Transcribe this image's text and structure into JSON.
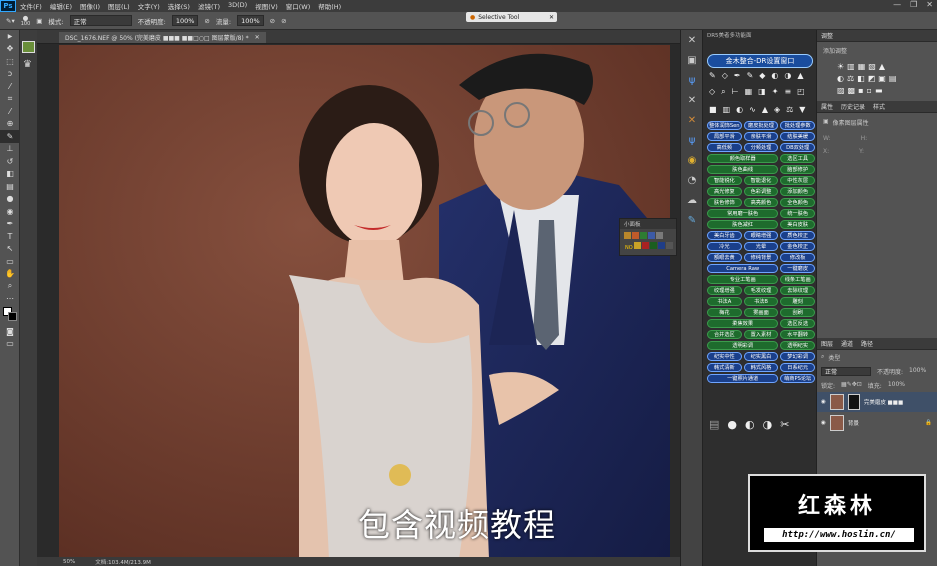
{
  "menubar": {
    "logo": "Ps",
    "items": [
      "文件(F)",
      "编辑(E)",
      "图像(I)",
      "图层(L)",
      "文字(Y)",
      "选择(S)",
      "滤镜(T)",
      "3D(D)",
      "视图(V)",
      "窗口(W)",
      "帮助(H)"
    ],
    "window_controls": [
      "—",
      "❐",
      "✕"
    ]
  },
  "options": {
    "brush_size": "100",
    "mode_label": "模式:",
    "mode_value": "正常",
    "opacity_label": "不透明度:",
    "opacity_value": "100%",
    "flow_label": "流量:",
    "flow_value": "100%"
  },
  "selective_tool": {
    "label": "Selective Tool"
  },
  "document": {
    "tab": "DSC_1676.NEF @ 50% (完美磨皮 ■■■ ■■□○□ 图层蒙版/8) *",
    "zoom": "50%",
    "doc_size": "文档:103.4M/213.9M",
    "subtitle": "包含视频教程"
  },
  "xiaomianban": {
    "title": "小面板",
    "swatches": [
      "#b8862b",
      "#c05a2a",
      "#2e7d32",
      "#3c5aa6",
      "#7a7a7a",
      "#c9a227",
      "#aa2222",
      "#1b5e20",
      "#1f3d87",
      "#555555"
    ],
    "no_label": "NO"
  },
  "dr_panel": {
    "title": "DR5美者多功能面",
    "main_button": "金木整合-DR设置窗口",
    "buttons": [
      {
        "label": "整体润饰Sen",
        "c": "b"
      },
      {
        "label": "磨皮批处理",
        "c": "b"
      },
      {
        "label": "批处理参数",
        "c": "b"
      },
      {
        "label": "局部平滑",
        "c": "b"
      },
      {
        "label": "亲肤平滑",
        "c": "b"
      },
      {
        "label": "结肤美缓",
        "c": "b"
      },
      {
        "label": "高低频",
        "c": "b"
      },
      {
        "label": "分频处理",
        "c": "b"
      },
      {
        "label": "DB双处理",
        "c": "b"
      },
      {
        "label": "颜色取样器",
        "c": "g",
        "w": 2
      },
      {
        "label": "选区工具",
        "c": "g"
      },
      {
        "label": "肤色曲线",
        "c": "g",
        "w": 2
      },
      {
        "label": "脑部修护",
        "c": "g"
      },
      {
        "label": "智能锐化",
        "c": "g"
      },
      {
        "label": "智能退化",
        "c": "g"
      },
      {
        "label": "中性灰层",
        "c": "g"
      },
      {
        "label": "高光修复",
        "c": "g"
      },
      {
        "label": "色彩调整",
        "c": "g"
      },
      {
        "label": "添加颜色",
        "c": "g"
      },
      {
        "label": "肤色修饰",
        "c": "g"
      },
      {
        "label": "高亮颜色",
        "c": "g"
      },
      {
        "label": "全色颜色",
        "c": "g"
      },
      {
        "label": "常用磨一肤色",
        "c": "g",
        "w": 2
      },
      {
        "label": "统一肤色",
        "c": "g"
      },
      {
        "label": "肤色减红",
        "c": "g",
        "w": 2
      },
      {
        "label": "美白皮肤",
        "c": "g"
      },
      {
        "label": "美白牙齿",
        "c": "b"
      },
      {
        "label": "眼睛增强",
        "c": "b"
      },
      {
        "label": "质色校正",
        "c": "b"
      },
      {
        "label": "冷光",
        "c": "b"
      },
      {
        "label": "光晕",
        "c": "b"
      },
      {
        "label": "金色校正",
        "c": "b"
      },
      {
        "label": "额眼去黄",
        "c": "b"
      },
      {
        "label": "修纯背景",
        "c": "b"
      },
      {
        "label": "修改板",
        "c": "b"
      },
      {
        "label": "Camera Raw",
        "c": "b",
        "w": 2
      },
      {
        "label": "一键磨皮",
        "c": "b"
      },
      {
        "label": "专业工笔画",
        "c": "g",
        "w": 2
      },
      {
        "label": "线条工笔画",
        "c": "g"
      },
      {
        "label": "纹理增强",
        "c": "g"
      },
      {
        "label": "毛发纹理",
        "c": "g"
      },
      {
        "label": "去除纹理",
        "c": "g"
      },
      {
        "label": "书法A",
        "c": "g"
      },
      {
        "label": "书法B",
        "c": "g"
      },
      {
        "label": "雕刻",
        "c": "g"
      },
      {
        "label": "梅花",
        "c": "g"
      },
      {
        "label": "雾画面",
        "c": "g"
      },
      {
        "label": "刮刷",
        "c": "g"
      },
      {
        "label": "柔焦效果",
        "c": "g",
        "w": 2
      },
      {
        "label": "选区反选",
        "c": "g"
      },
      {
        "label": "合并选区",
        "c": "g"
      },
      {
        "label": "置入素材",
        "c": "g"
      },
      {
        "label": "水平翻转",
        "c": "g"
      },
      {
        "label": "透明彩调",
        "c": "g",
        "w": 2
      },
      {
        "label": "透明纪实",
        "c": "g"
      },
      {
        "label": "纪实中性",
        "c": "b"
      },
      {
        "label": "纪实黑白",
        "c": "b"
      },
      {
        "label": "梦幻彩调",
        "c": "b"
      },
      {
        "label": "韩式清新",
        "c": "b"
      },
      {
        "label": "韩式风格",
        "c": "b"
      },
      {
        "label": "日系纪元",
        "c": "b"
      },
      {
        "label": "一键照片通道",
        "c": "b",
        "w": 2
      },
      {
        "label": "萌商PS论坛",
        "c": "b"
      }
    ]
  },
  "adjustments": {
    "tab1": "调整",
    "add_label": "添加调整",
    "props_tabs": [
      "属性",
      "历史记录",
      "样式"
    ],
    "mask_label": "像素图层属性",
    "w_label": "W:",
    "h_label": "H:",
    "x_label": "X:",
    "y_label": "Y:"
  },
  "layers": {
    "tabs": [
      "图层",
      "通道",
      "路径"
    ],
    "kind": "类型",
    "blend": "正常",
    "opacity_label": "不透明度:",
    "opacity_value": "100%",
    "lock_label": "锁定:",
    "fill_label": "填充:",
    "fill_value": "100%",
    "rows": [
      {
        "name": "完美磨皮 ■■■"
      },
      {
        "name": "背景"
      }
    ]
  },
  "watermark": {
    "brand": "红森林",
    "url": "http://www.hoslin.cn/"
  }
}
